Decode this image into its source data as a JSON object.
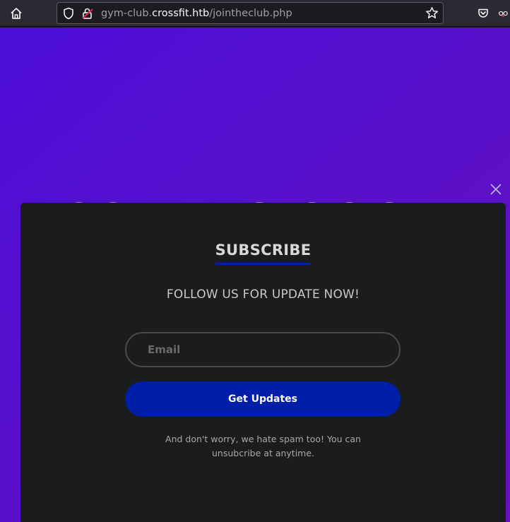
{
  "browser": {
    "url_prefix": "gym-club.",
    "url_host": "crossfit.htb",
    "url_path": "/jointheclub.php"
  },
  "page": {
    "hero_title": "COMING SOON"
  },
  "modal": {
    "heading": "SUBSCRIBE",
    "subheading": "FOLLOW US FOR UPDATE NOW!",
    "email_placeholder": "Email",
    "submit_label": "Get Updates",
    "note_line1": "And don't worry, we hate spam too! You can",
    "note_line2": "unsubcribe at anytime."
  },
  "icons": {
    "home": "home-icon",
    "shield": "tracking-shield-icon",
    "lock": "insecure-lock-icon",
    "star": "bookmark-star-icon",
    "pocket": "pocket-icon",
    "close": "close-icon"
  },
  "colors": {
    "page_gradient_start": "#4d0fd9",
    "page_gradient_end": "#6611c2",
    "modal_bg": "#1b1c1e",
    "accent_blue": "#001fa8"
  }
}
